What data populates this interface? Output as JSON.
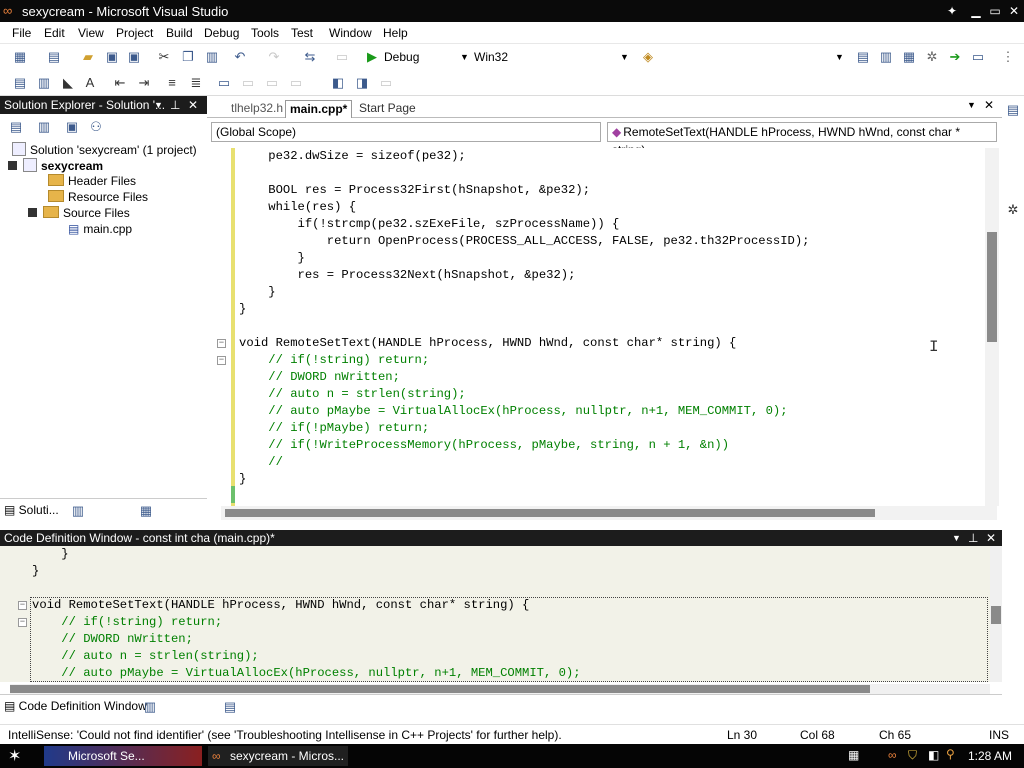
{
  "window": {
    "title": "sexycream - Microsoft Visual Studio"
  },
  "menu": [
    "File",
    "Edit",
    "View",
    "Project",
    "Build",
    "Debug",
    "Tools",
    "Test",
    "Window",
    "Help"
  ],
  "toolbar": {
    "config": "Debug",
    "platform": "Win32"
  },
  "solution_explorer": {
    "header": "Solution Explorer - Solution '...",
    "solution": "Solution 'sexycream' (1 project)",
    "project": "sexycream",
    "folders": [
      "Header Files",
      "Resource Files",
      "Source Files"
    ],
    "file": "main.cpp",
    "bottom_tab": "Soluti..."
  },
  "doc_tabs": [
    "tlhelp32.h",
    "main.cpp*",
    "Start Page"
  ],
  "scope": {
    "left": "(Global Scope)",
    "right": "RemoteSetText(HANDLE hProcess, HWND hWnd, const char * string)"
  },
  "code_lines": [
    "    pe32.dwSize = sizeof(pe32);",
    "",
    "    BOOL res = Process32First(hSnapshot, &pe32);",
    "    while(res) {",
    "        if(!strcmp(pe32.szExeFile, szProcessName)) {",
    "            return OpenProcess(PROCESS_ALL_ACCESS, FALSE, pe32.th32ProcessID);",
    "        }",
    "        res = Process32Next(hSnapshot, &pe32);",
    "    }",
    "}",
    "",
    "void RemoteSetText(HANDLE hProcess, HWND hWnd, const char* string) {",
    "    // if(!string) return;",
    "    // DWORD nWritten;",
    "    // auto n = strlen(string);",
    "    // auto pMaybe = VirtualAllocEx(hProcess, nullptr, n+1, MEM_COMMIT, 0);",
    "    // if(!pMaybe) return;",
    "    // if(!WriteProcessMemory(hProcess, pMaybe, string, n + 1, &n))",
    "    //",
    "}"
  ],
  "cdw": {
    "header": "Code Definition Window - const int cha (main.cpp)*",
    "lines": [
      "    }",
      "}",
      "",
      "void RemoteSetText(HANDLE hProcess, HWND hWnd, const char* string) {",
      "    // if(!string) return;",
      "    // DWORD nWritten;",
      "    // auto n = strlen(string);",
      "    // auto pMaybe = VirtualAllocEx(hProcess, nullptr, n+1, MEM_COMMIT, 0);"
    ],
    "tab": "Code Definition Window"
  },
  "status": {
    "message": "IntelliSense: 'Could not find identifier'   (see 'Troubleshooting Intellisense in C++ Projects' for further help).",
    "ln": "Ln 30",
    "col": "Col 68",
    "ch": "Ch 65",
    "mode": "INS"
  },
  "taskbar": {
    "item1": "Microsoft Se...",
    "item2": "sexycream - Micros...",
    "time": "1:28 AM"
  }
}
